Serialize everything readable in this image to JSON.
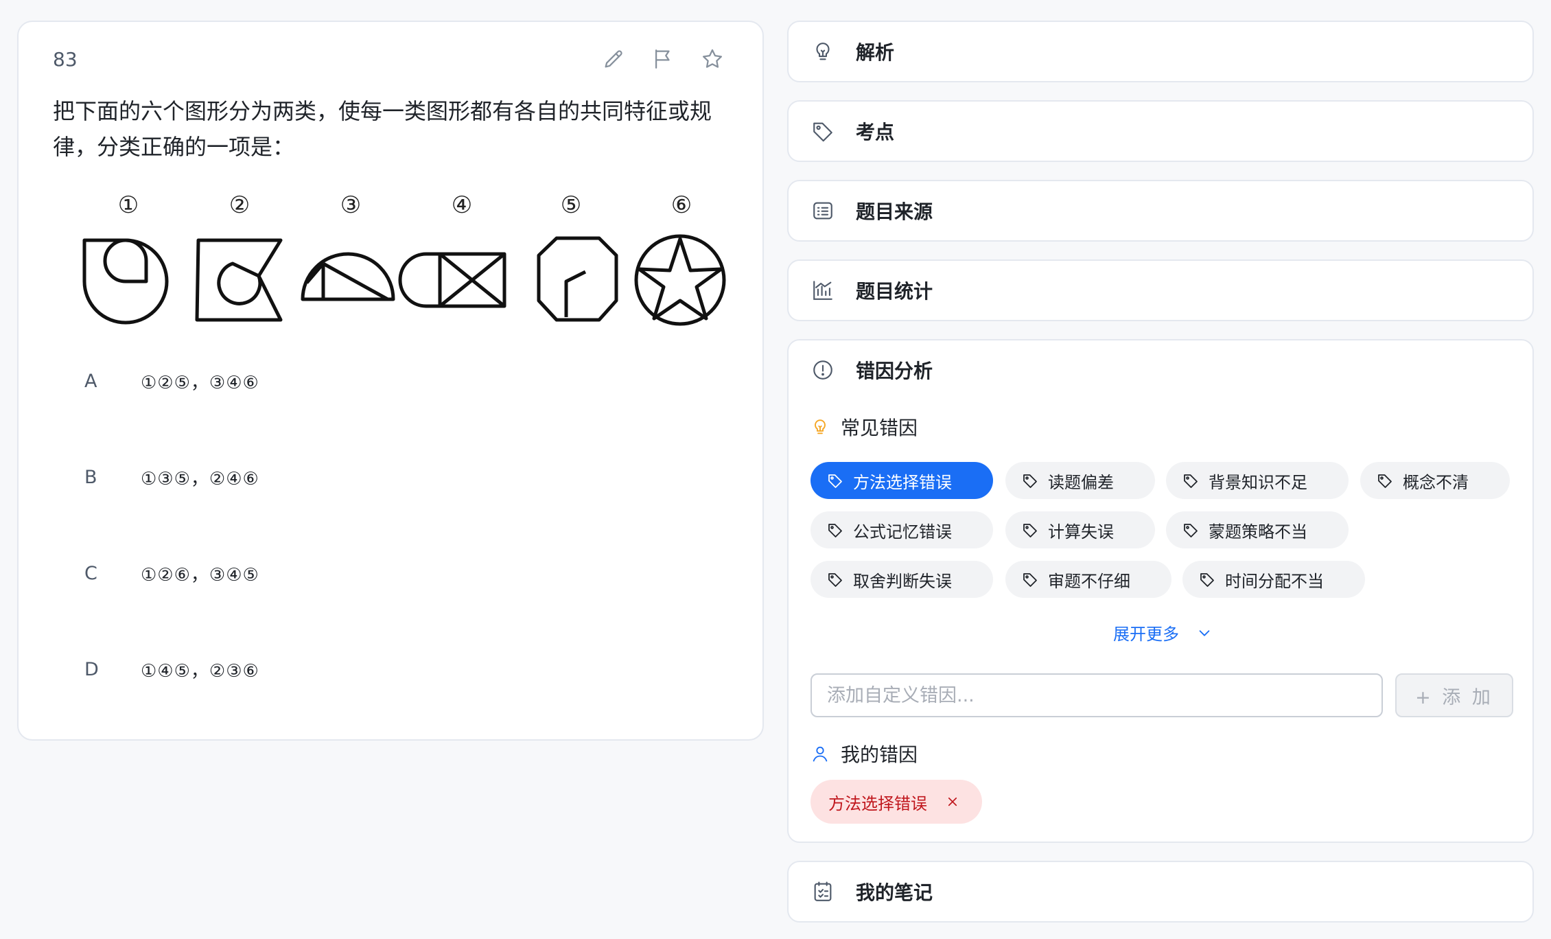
{
  "question": {
    "number": "83",
    "stem": "把下面的六个图形分为两类，使每一类图形都有各自的共同特征或规律，分类正确的一项是：",
    "figure_labels": [
      "①",
      "②",
      "③",
      "④",
      "⑤",
      "⑥"
    ],
    "options": [
      {
        "letter": "A",
        "text": "①②⑤，③④⑥"
      },
      {
        "letter": "B",
        "text": "①③⑤，②④⑥"
      },
      {
        "letter": "C",
        "text": "①②⑥，③④⑤"
      },
      {
        "letter": "D",
        "text": "①④⑤，②③⑥"
      }
    ],
    "tools": [
      "edit-icon",
      "flag-icon",
      "star-icon"
    ]
  },
  "panels": {
    "analysis": {
      "title": "解析",
      "icon": "bulb-icon"
    },
    "key_points": {
      "title": "考点",
      "icon": "tag-icon"
    },
    "source": {
      "title": "题目来源",
      "icon": "list-icon"
    },
    "stats": {
      "title": "题目统计",
      "icon": "bar-chart-icon"
    },
    "error_analysis": {
      "title": "错因分析",
      "icon": "alert-circle-icon",
      "common_title": "常见错因",
      "common_tags": [
        {
          "label": "方法选择错误",
          "active": true
        },
        {
          "label": "读题偏差",
          "active": false
        },
        {
          "label": "背景知识不足",
          "active": false
        },
        {
          "label": "概念不清",
          "active": false
        },
        {
          "label": "公式记忆错误",
          "active": false
        },
        {
          "label": "计算失误",
          "active": false
        },
        {
          "label": "蒙题策略不当",
          "active": false
        },
        {
          "label": "取舍判断失误",
          "active": false
        },
        {
          "label": "审题不仔细",
          "active": false
        },
        {
          "label": "时间分配不当",
          "active": false
        }
      ],
      "expand_label": "展开更多",
      "custom_placeholder": "添加自定义错因...",
      "add_label": "+ 添 加",
      "my_title": "我的错因",
      "my_tags": [
        {
          "label": "方法选择错误"
        }
      ]
    },
    "notes": {
      "title": "我的笔记",
      "icon": "notes-icon"
    }
  },
  "colors": {
    "accent": "#1a6ef5",
    "bulb_orange": "#f5a623",
    "my_tag_bg": "#fde2e2",
    "my_tag_text": "#c0171d"
  }
}
